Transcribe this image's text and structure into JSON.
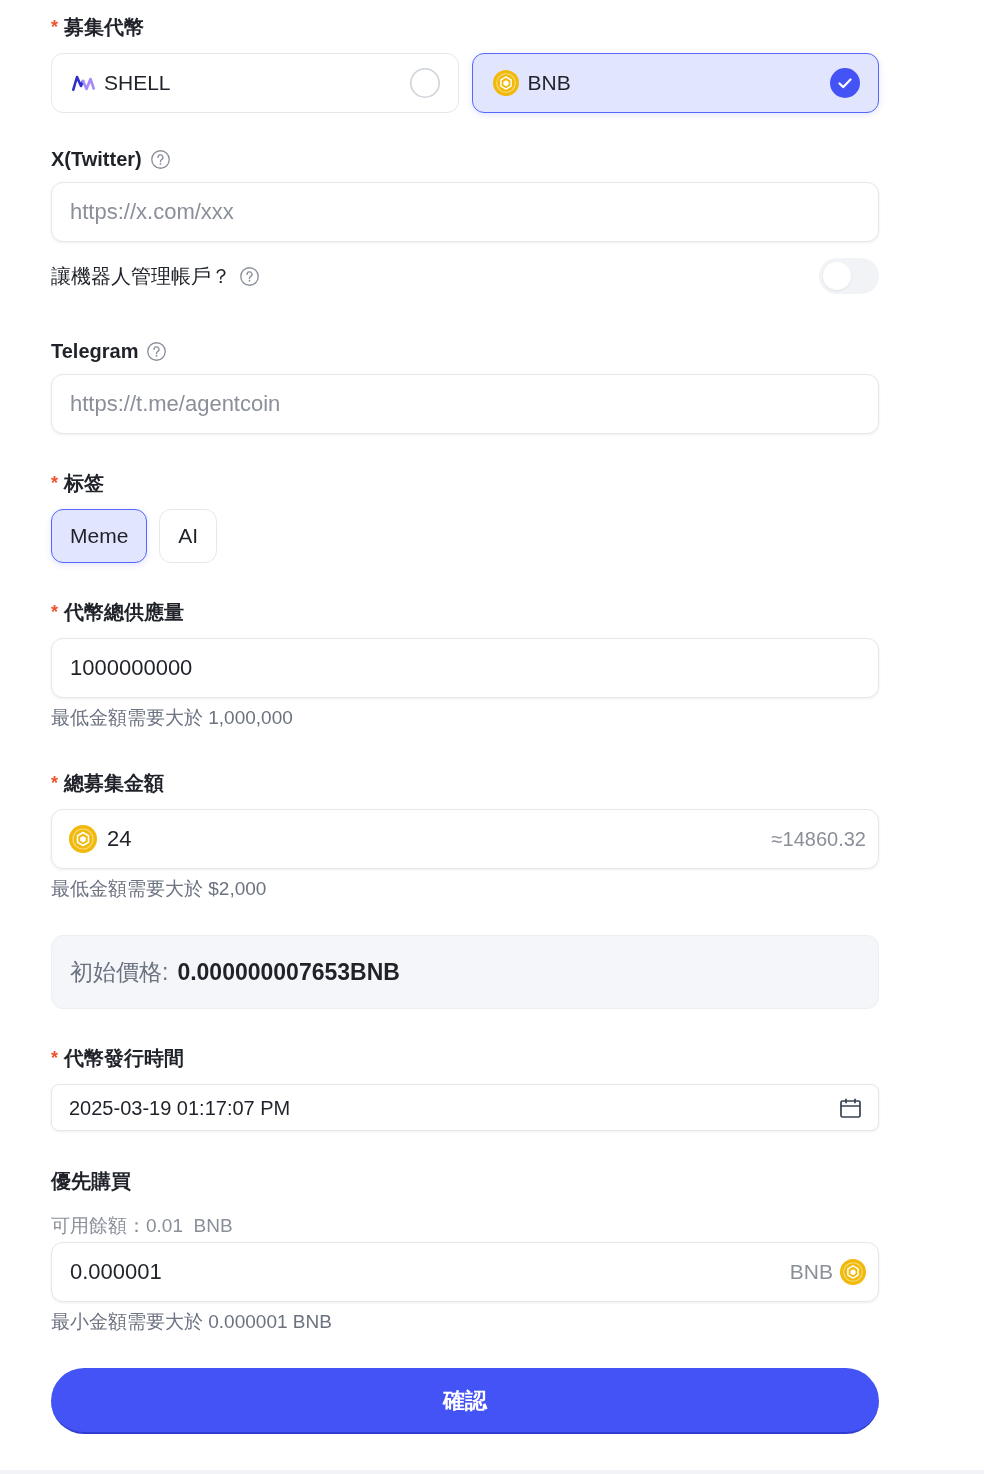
{
  "currency": {
    "required_mark": "*",
    "label": "募集代幣",
    "options": [
      {
        "name": "SHELL",
        "kind": "shell",
        "selected": false
      },
      {
        "name": "BNB",
        "kind": "bnb",
        "selected": true
      }
    ]
  },
  "twitter": {
    "label": "X(Twitter)",
    "placeholder": "https://x.com/xxx"
  },
  "bot_management": {
    "label": "讓機器人管理帳戶？",
    "on": false
  },
  "telegram": {
    "label": "Telegram",
    "placeholder": "https://t.me/agentcoin"
  },
  "tags": {
    "required_mark": "*",
    "label": "标签",
    "options": [
      {
        "name": "Meme",
        "selected": true
      },
      {
        "name": "AI",
        "selected": false
      }
    ]
  },
  "total_supply": {
    "required_mark": "*",
    "label": "代幣總供應量",
    "value": "1000000000",
    "hint": "最低金額需要大於 1,000,000"
  },
  "total_raise": {
    "required_mark": "*",
    "label": "總募集金額",
    "value": "24",
    "estimate": "≈14860.32",
    "hint": "最低金額需要大於 $2,000"
  },
  "initial_price": {
    "label": "初始價格:",
    "value": "0.000000007653BNB"
  },
  "launch_time": {
    "required_mark": "*",
    "label": "代幣發行時間",
    "value": "2025-03-19 01:17:07 PM"
  },
  "priority_purchase": {
    "label": "優先購買",
    "balance": "可用餘額：0.01  BNB",
    "value": "0.000001",
    "unit": "BNB",
    "hint": "最小金額需要大於 0.000001 BNB"
  },
  "confirm_button": "確認"
}
